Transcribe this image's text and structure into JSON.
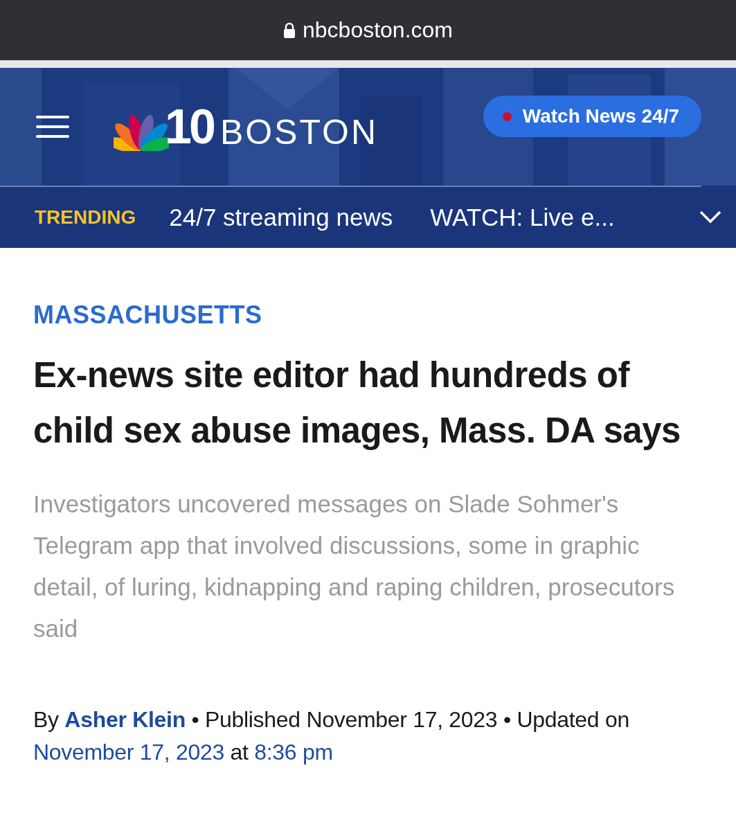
{
  "browser_bar": {
    "url": "nbcboston.com"
  },
  "header": {
    "logo_number": "10",
    "logo_city": "BOSTON",
    "watch_button": "Watch News 24/7"
  },
  "trending": {
    "label": "TRENDING",
    "items": [
      "24/7 streaming news",
      "WATCH: Live e..."
    ]
  },
  "article": {
    "section": "MASSACHUSETTS",
    "headline": "Ex-news site editor had hundreds of child sex abuse images, Mass. DA says",
    "summary": "Investigators uncovered messages on Slade Sohmer's Telegram app that involved discussions, some in graphic detail, of luring, kidnapping and raping children, prosecutors said",
    "byline": {
      "prefix": "By",
      "author": "Asher Klein",
      "middle": "• Published November 17, 2023 • Updated on",
      "updated_date": "November 17, 2023",
      "at": "at",
      "updated_time": "8:36 pm"
    }
  }
}
